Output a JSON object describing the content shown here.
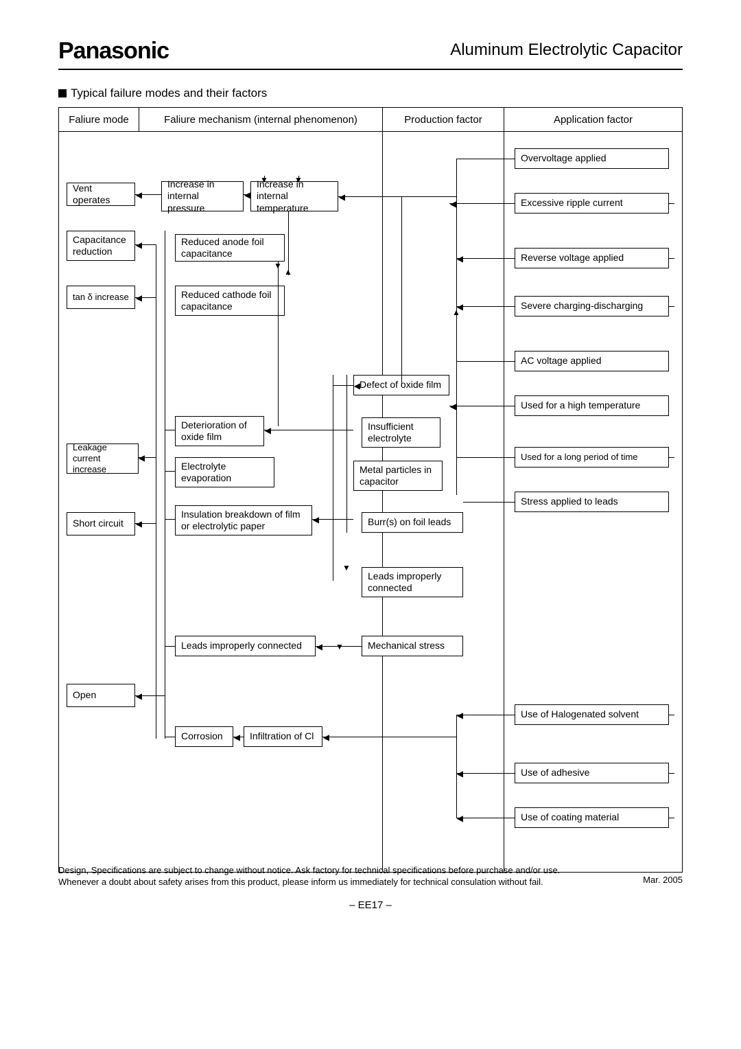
{
  "header": {
    "brand": "Panasonic",
    "title": "Aluminum Electrolytic Capacitor"
  },
  "section_title": "Typical failure modes and their factors",
  "columns": {
    "failure_mode": "Faliure mode",
    "mechanism": "Faliure mechanism (internal phenomenon)",
    "production": "Production factor",
    "application": "Application factor"
  },
  "modes": {
    "vent": "Vent operates",
    "cap_red": "Capacitance reduction",
    "tand": "tan δ increase",
    "leak": "Leakage current increase",
    "short": "Short circuit",
    "open": "Open"
  },
  "mech": {
    "press": "Increase in internal pressure",
    "temp": "Increase in internal temperature",
    "anode": "Reduced anode foil capacitance",
    "cathode": "Reduced cathode foil capacitance",
    "deter": "Deterioration of oxide film",
    "evap": "Electrolyte evaporation",
    "insbreak": "Insulation breakdown of film or electrolytic paper",
    "leads2": "Leads improperly connected",
    "corr": "Corrosion",
    "infil": "Infiltration of Cl"
  },
  "prod": {
    "defect": "Defect of oxide film",
    "insuf": "Insufficient electrolyte",
    "metal": "Metal particles in capacitor",
    "burr": "Burr(s) on foil leads",
    "leadsimp": "Leads improperly connected",
    "mechstress": "Mechanical stress"
  },
  "app": {
    "over": "Overvoltage applied",
    "ripple": "Excessive ripple current",
    "rev": "Reverse voltage applied",
    "charge": "Severe charging-discharging",
    "ac": "AC voltage applied",
    "hightemp": "Used for a high temperature",
    "longtime": "Used for a long period of time",
    "stress": "Stress applied to leads",
    "halog": "Use of Halogenated solvent",
    "adh": "Use of adhesive",
    "coat": "Use of coating material"
  },
  "footer": {
    "line1": "Design, Specifications are subject to change without notice.  Ask factory for technical specifications before purchase and/or use.",
    "line2": "Whenever a doubt about safety arises from this product, please inform us immediately for technical consulation without fail.",
    "date": "Mar. 2005",
    "page": "– EE17 –"
  }
}
